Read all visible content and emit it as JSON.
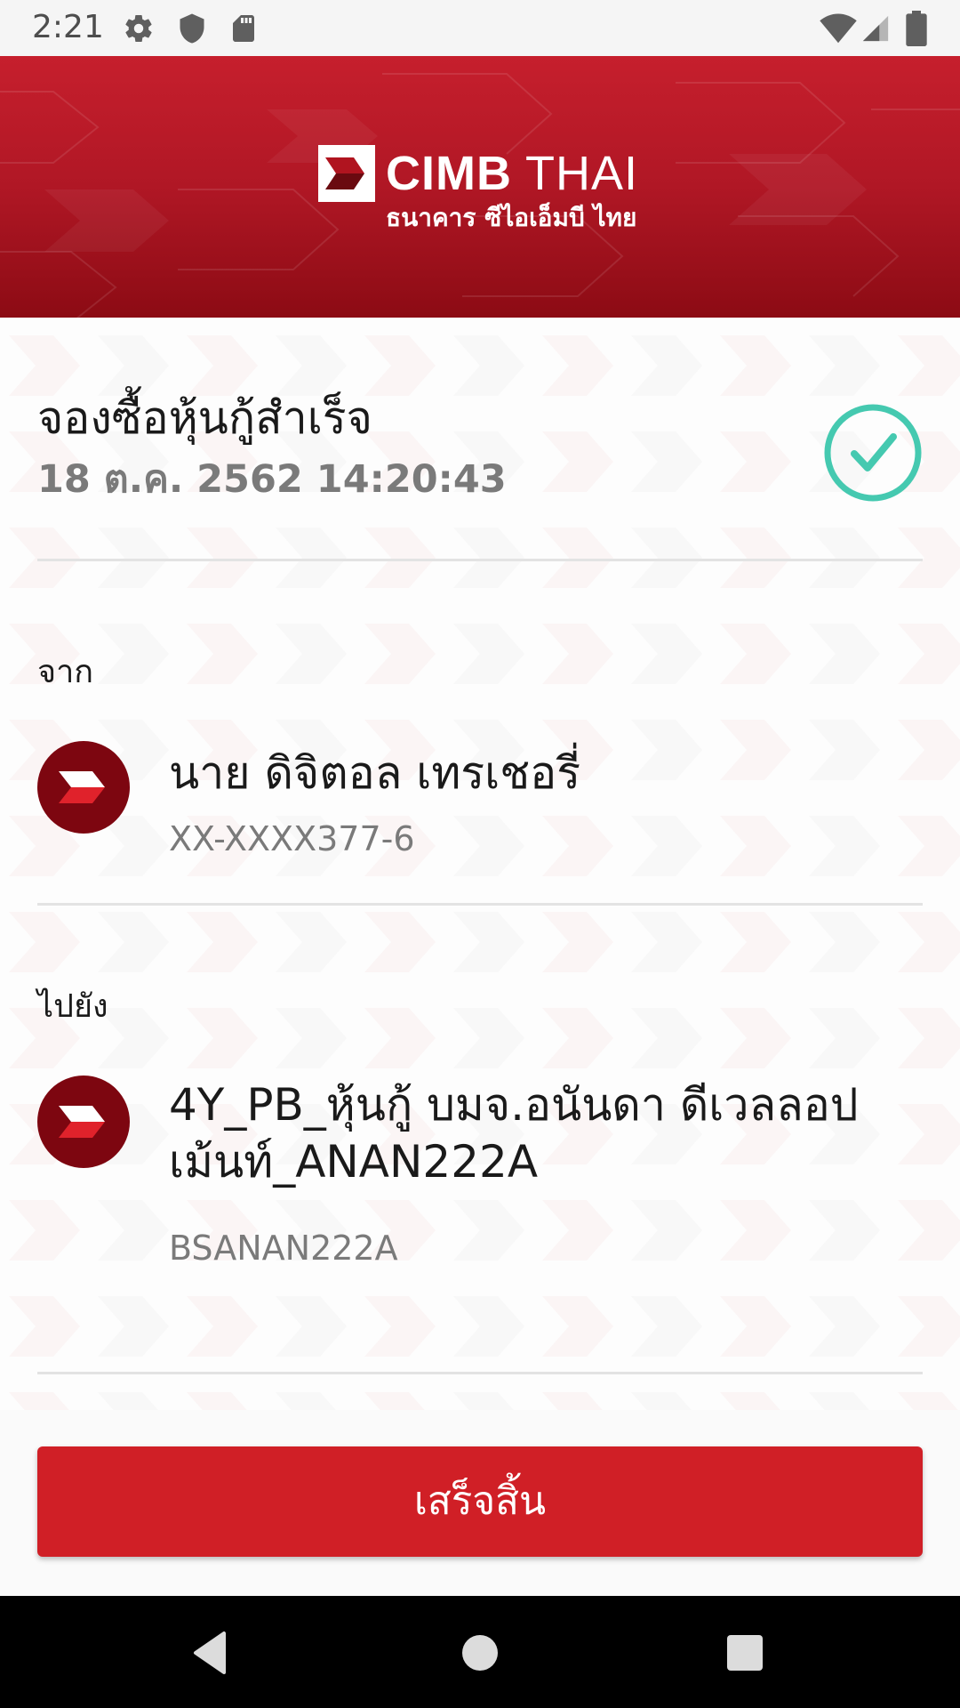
{
  "status_bar": {
    "time": "2:21",
    "left_icons": [
      "settings-icon",
      "shield-icon",
      "sd-card-icon"
    ],
    "right_icons": [
      "wifi-icon",
      "cell-signal-icon",
      "battery-icon"
    ]
  },
  "header": {
    "logo_name_bold": "CIMB",
    "logo_name_light": " THAI",
    "logo_subtitle": "ธนาคาร ซีไอเอ็มบี ไทย",
    "background_color": "#c61f2d"
  },
  "result": {
    "title": "จองซื้อหุ้นกู้สำเร็จ",
    "datetime": "18 ต.ค. 2562 14:20:43",
    "status_icon": "check-circle-icon",
    "status_color": "#45c9b0"
  },
  "from": {
    "label": "จาก",
    "name": "นาย ดิจิตอล เทรเชอรี่",
    "account": "XX-XXXX377-6"
  },
  "to": {
    "label": "ไปยัง",
    "name": "4Y_PB_หุ้นกู้ บมจ.อนันดา ดีเวลลอปเม้นท์_ANAN222A",
    "account": "BSANAN222A"
  },
  "actions": {
    "done_label": "เสร็จสิ้น",
    "done_color": "#d01f26"
  },
  "nav": {
    "icons": [
      "back-icon",
      "home-icon",
      "recents-icon"
    ]
  }
}
